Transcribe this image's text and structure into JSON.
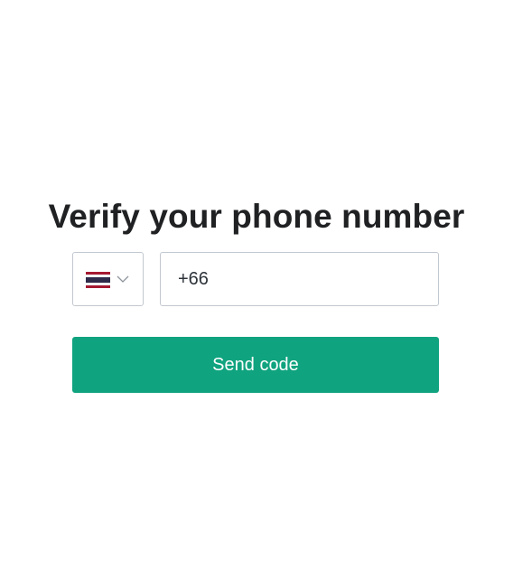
{
  "page": {
    "title": "Verify your phone number"
  },
  "form": {
    "country": {
      "flag_icon": "thailand-flag-icon",
      "dropdown_icon": "chevron-down-icon"
    },
    "phone": {
      "value": "+66"
    },
    "submit": {
      "label": "Send code"
    }
  },
  "colors": {
    "primary": "#10a37f",
    "text": "#202123",
    "border": "#c2c8d0",
    "flag_red": "#a51931",
    "flag_white": "#f4f5f8",
    "flag_blue": "#2d2a4a"
  }
}
